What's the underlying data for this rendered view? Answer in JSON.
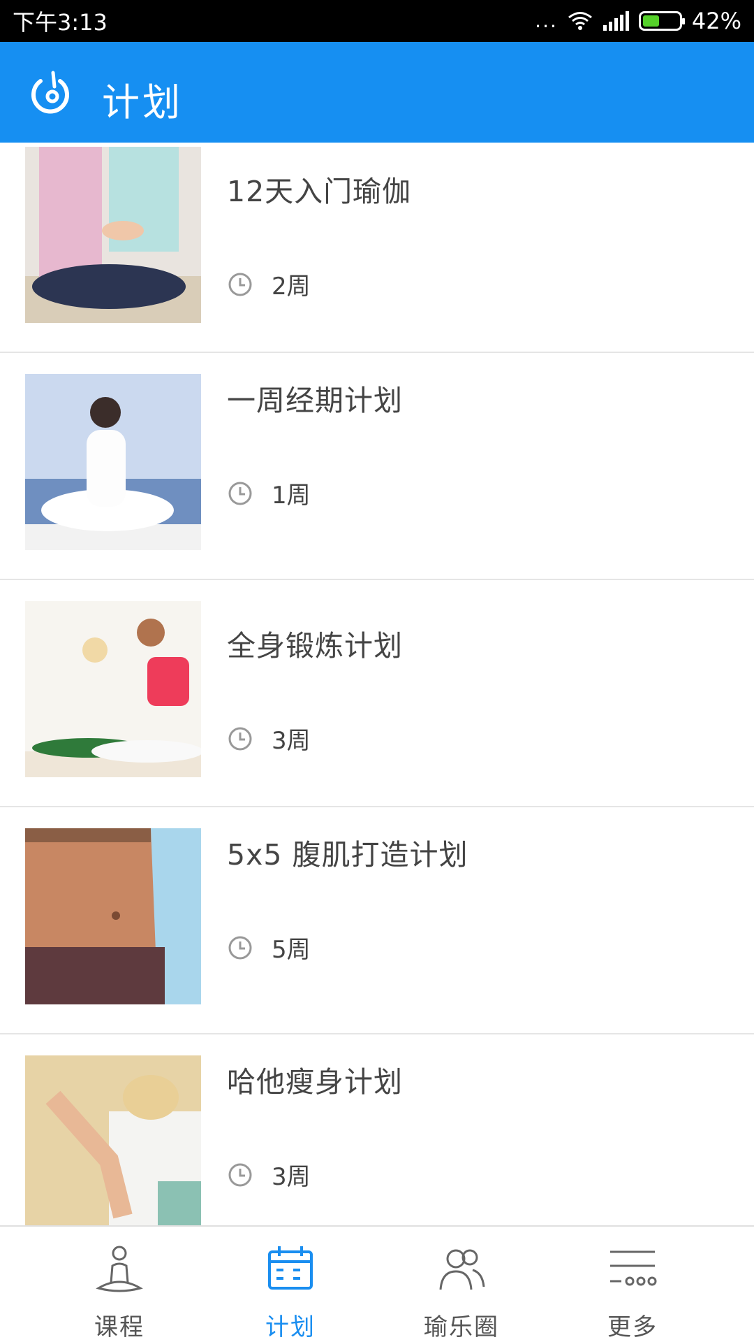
{
  "status_bar": {
    "time": "下午3:13",
    "dots": "...",
    "battery": "42%"
  },
  "app_bar": {
    "title": "计划"
  },
  "plans": [
    {
      "name": "12天入门瑜伽",
      "duration": "2周"
    },
    {
      "name": "一周经期计划",
      "duration": "1周"
    },
    {
      "name": "全身锻炼计划",
      "duration": "3周"
    },
    {
      "name": "5x5 腹肌打造计划",
      "duration": "5周"
    },
    {
      "name": "哈他瘦身计划",
      "duration": "3周"
    }
  ],
  "tabs": [
    {
      "label": "课程",
      "icon": "meditation-icon"
    },
    {
      "label": "计划",
      "icon": "calendar-icon"
    },
    {
      "label": "瑜乐圈",
      "icon": "people-icon"
    },
    {
      "label": "更多",
      "icon": "more-icon"
    }
  ],
  "colors": {
    "accent": "#168ff2",
    "active_tab": "#1a8ef0",
    "battery_fill": "#55d12a"
  }
}
